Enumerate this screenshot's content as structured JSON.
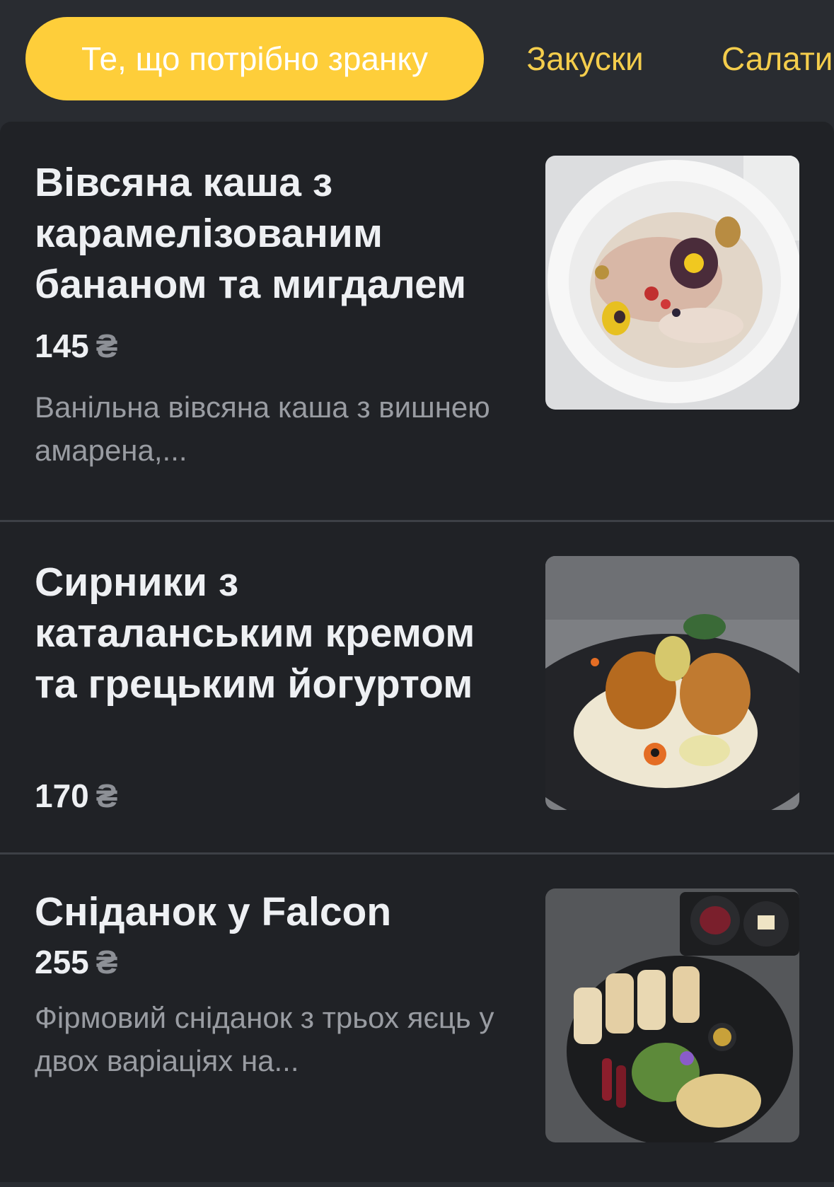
{
  "tabs": [
    {
      "label": "Те, що потрібно зранку",
      "active": true
    },
    {
      "label": "Закуски",
      "active": false
    },
    {
      "label": "Салати",
      "active": false
    }
  ],
  "colors": {
    "background": "#292c31",
    "panel": "#202226",
    "accent": "#fece3a",
    "tab_text": "#f4cd4c"
  },
  "items": [
    {
      "title": "Вівсяна каша з карамелізованим бананом та мигдалем",
      "price": "145",
      "currency": "₴",
      "description": "Ванільна вівсяна каша з вишнею амарена,...",
      "image_icon": "oatmeal-photo"
    },
    {
      "title": "Сирники з каталанським кремом та грецьким йогуртом",
      "price": "170",
      "currency": "₴",
      "description": "",
      "image_icon": "syrniki-photo"
    },
    {
      "title": "Сніданок у Falcon",
      "price": "255",
      "currency": "₴",
      "description": "Фірмовий сніданок з трьох яєць у двох варіаціях на...",
      "image_icon": "breakfast-photo"
    }
  ]
}
